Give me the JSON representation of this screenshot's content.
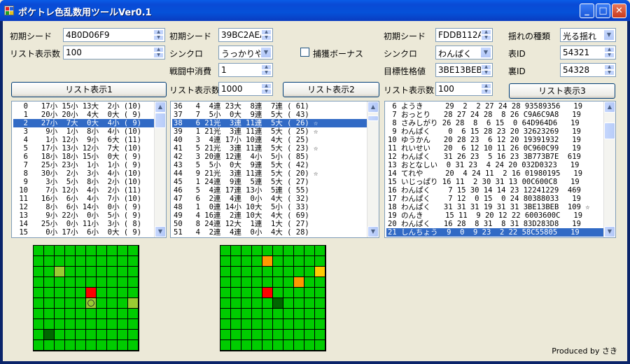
{
  "window": {
    "title": "ポケトレ色乱数用ツールVer0.1"
  },
  "colors": {
    "grass": "#00cc00",
    "light": "#99cc33",
    "red": "#ff0000",
    "dark": "#006600",
    "orange": "#ff9900",
    "yellow": "#ffcc00",
    "selection": "#316ac5"
  },
  "panel1": {
    "seed_label": "初期シード",
    "seed_value": "4B0D06F9",
    "list_count_label": "リスト表示数",
    "list_count_value": "100",
    "button": "リスト表示1",
    "rows": [
      "  0   17小 15小 13大  2小 (10)",
      "  1   20小 20小  4大  0大 ( 9)",
      "  2   27小  7大  0大  4小 ( 9)",
      "  3    9小  1小  8小  4小 (10)",
      "  4    1小 12小  9小  6大 (11)",
      "  5   17小 13小 12小  7大 (10)",
      "  6   18小 18小 15小  0大 ( 9)",
      "  7   25小 23小  1小  1小 ( 9)",
      "  8   30小  2小  3小  4小 (10)",
      "  9    3小  5小  8小  2小 (10)",
      " 10    7小 12小  4小  2小 (11)",
      " 11   16小  6小  4小  7小 (10)",
      " 12    8小  6小 14小  0小 ( 9)",
      " 13    9小 22小  0小  5小 ( 9)",
      " 14   25小  0小 11小  3小 ( 8)",
      " 15    0小 17小  6小  0大 ( 9)"
    ]
  },
  "panel2": {
    "seed_label": "初期シード",
    "seed_value": "39BC2AEA",
    "sync_label": "シンクロ",
    "sync_value": "うっかりや",
    "capture_bonus_label": "捕獲ボーナス",
    "battle_label": "戦闘中消費",
    "battle_value": "1",
    "list_count_label": "リスト表示数",
    "list_count_value": "1000",
    "button": "リスト表示2",
    "rows": [
      "36   4  4連 23大  8連  7連 ( 61)",
      "37   7  5小  0大  9連  5大 ( 43)",
      "38   6 21光  3連 11連  5大 ( 26) ☆",
      "39   1 21光  3連 11連  5大 ( 25) ☆",
      "40   3  4連 17小 10連  4大 ( 25)",
      "41   5 21光  3連 11連  5大 ( 23) ☆",
      "42   3 20連 12連  4小  5小 ( 85)",
      "43   5  5小  0大  9連  5大 ( 42)",
      "44   9 21光  3連 11連  5大 ( 20) ☆",
      "45   1 24連  9連  5連  5大 ( 27)",
      "46   5  4連 17連 13小  5連 ( 55)",
      "47   6  2連  4連  0小  4大 ( 32)",
      "48   1  0連 14小 10大  5小 ( 33)",
      "49   4 16連  2連 10大  4大 ( 69)",
      "50   8 24連 12大  1連  1大 ( 27)",
      "51   4  2連  4連  0小  4大 ( 28)"
    ]
  },
  "panel3": {
    "seed_label": "初期シード",
    "seed_value": "FDDB112A",
    "sync_label": "シンクロ",
    "sync_value": "わんぱく",
    "target_label": "目標性格値",
    "target_value": "3BE13BEB",
    "list_count_label": "リスト表示数",
    "list_count_value": "100",
    "shake_label": "揺れの種類",
    "shake_value": "光る揺れ",
    "front_id_label": "表ID",
    "front_id_value": "54321",
    "back_id_label": "裏ID",
    "back_id_value": "54328",
    "button": "リスト表示3",
    "rows": [
      " 6 ようき     29  2  2 27 24 28 93589356   19",
      " 7 おっとり   28 27 24 28  8 26 C9A6C9A8   19",
      " 8 さみしがり 26 28  8  6 15  0 64D964D6   19",
      " 9 わんぱく    0  6 15 28 23 20 32623269   19",
      "10 ゆうかん   20 28 23  6 12 20 19391932   19",
      "11 れいせい   20  6 12 10 11 26 0C960C99   19",
      "12 わんぱく   31 26 23  5 16 23 3B773B7E  619",
      "13 おとなしい  0 31 23  4 24 20 032D0323   19",
      "14 てれや     20  4 24 11  2 16 01980195   19",
      "15 いじっぱり 16 11  2 30 31 13 00C600C8   19",
      "16 わんぱく    7 15 30 14 14 23 12241229  469",
      "17 わんぱく    7 12  0 15  0 24 80388033   19",
      "18 わんぱく   31 31 31 19 31 31 3BE13BEB  109 ☆",
      "19 のんき     15 11  9 20 12 22 6003600C   19",
      "20 わんぱく   16 28  8 31  8 31 83D283D8   19",
      "21 しんちょう  9  0  9 23  2 22 58C55805   19"
    ]
  },
  "credit": "Produced by さき"
}
